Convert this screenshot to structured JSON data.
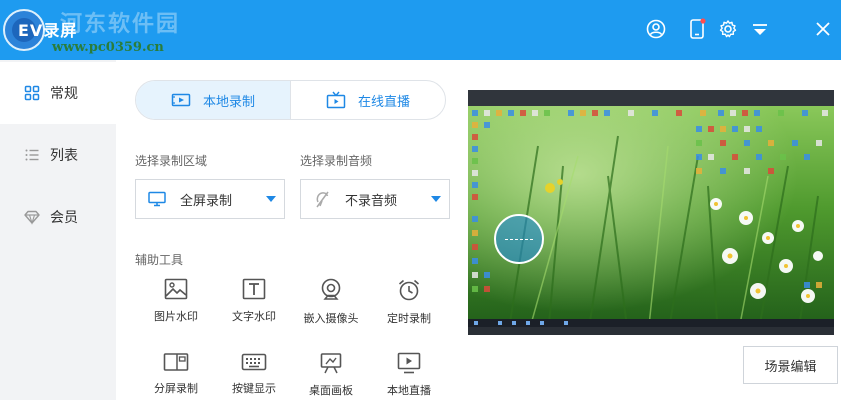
{
  "app": {
    "title": "EV录屏",
    "watermark_text": "河东软件园",
    "watermark_url": "www.pc0359.cn",
    "accent": "#1e9bf0"
  },
  "titlebar_icons": [
    "user-icon",
    "mobile-icon",
    "gear-icon",
    "menu-icon",
    "close-icon"
  ],
  "sidebar": {
    "items": [
      {
        "label": "常规",
        "icon": "grid-icon",
        "active": true
      },
      {
        "label": "列表",
        "icon": "list-icon",
        "active": false
      },
      {
        "label": "会员",
        "icon": "diamond-icon",
        "active": false
      }
    ]
  },
  "mode_tabs": [
    {
      "label": "本地录制",
      "icon": "record-icon",
      "active": true
    },
    {
      "label": "在线直播",
      "icon": "tv-icon",
      "active": false
    }
  ],
  "region": {
    "label": "选择录制区域",
    "value": "全屏录制",
    "icon": "monitor-icon"
  },
  "audio": {
    "label": "选择录制音频",
    "value": "不录音频",
    "icon": "mic-off-icon"
  },
  "tools": {
    "label": "辅助工具",
    "items": [
      {
        "label": "图片水印",
        "icon": "image-icon"
      },
      {
        "label": "文字水印",
        "icon": "text-icon"
      },
      {
        "label": "嵌入摄像头",
        "icon": "webcam-icon"
      },
      {
        "label": "定时录制",
        "icon": "alarm-icon"
      },
      {
        "label": "分屏录制",
        "icon": "split-screen-icon"
      },
      {
        "label": "按键显示",
        "icon": "keyboard-icon"
      },
      {
        "label": "桌面画板",
        "icon": "easel-icon"
      },
      {
        "label": "本地直播",
        "icon": "play-screen-icon"
      }
    ]
  },
  "preview": {
    "description_icon": "desktop-preview"
  },
  "scene_button": {
    "label": "场景编辑"
  }
}
